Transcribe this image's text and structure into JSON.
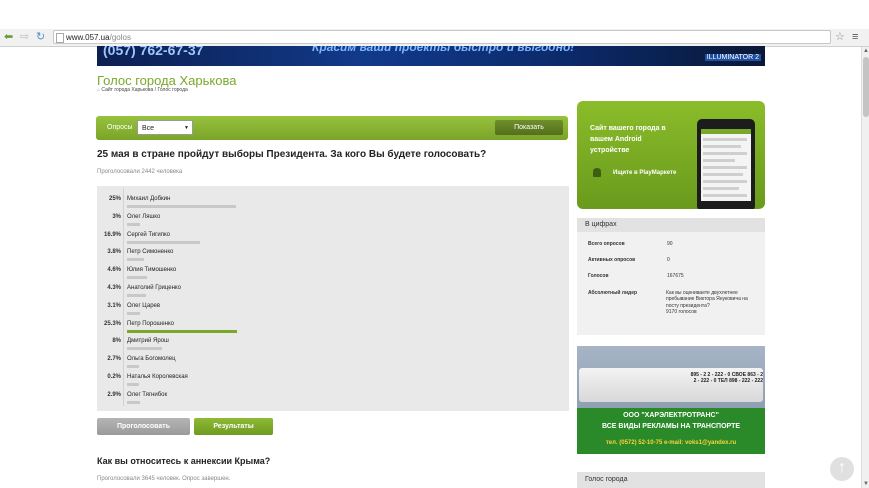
{
  "browser": {
    "url_host": "www.057.ua",
    "url_path": "/golos",
    "back_icon": "arrow-left-icon",
    "forward_icon": "arrow-right-icon",
    "reload_icon": "reload-icon",
    "star_glyph": "☆",
    "menu_glyph": "≡",
    "back_glyph": "⬅",
    "forward_glyph": "⇨",
    "reload_glyph": "↻"
  },
  "banner": {
    "phone": "(057) 762-67-37",
    "slogan": "Красим ваши проекты быстро и выгодно!",
    "brand": "ILLUMINATOR 2"
  },
  "page": {
    "title": "Голос города Харькова",
    "breadcrumb": "Сайт города Харькова / Голос города"
  },
  "filter": {
    "label": "Опросы",
    "selected": "Все",
    "show_button": "Показать"
  },
  "poll": {
    "question": "25 мая в стране пройдут выборы Президента. За кого Вы будете голосовать?",
    "voted": "Проголосовали 2442 человека",
    "options": [
      {
        "pct": "25%",
        "name": "Михаил Добкин",
        "value": 25
      },
      {
        "pct": "3%",
        "name": "Олег Ляшко",
        "value": 3
      },
      {
        "pct": "16.9%",
        "name": "Сергей Тигипко",
        "value": 16.9
      },
      {
        "pct": "3.8%",
        "name": "Петр Симоненко",
        "value": 3.8
      },
      {
        "pct": "4.6%",
        "name": "Юлия Тимошенко",
        "value": 4.6
      },
      {
        "pct": "4.3%",
        "name": "Анатолий Гриценко",
        "value": 4.3
      },
      {
        "pct": "3.1%",
        "name": "Олег Царев",
        "value": 3.1
      },
      {
        "pct": "25.3%",
        "name": "Петр Порошенко",
        "value": 25.3
      },
      {
        "pct": "8%",
        "name": "Дмитрий Ярош",
        "value": 8
      },
      {
        "pct": "2.7%",
        "name": "Ольга Богомолец",
        "value": 2.7
      },
      {
        "pct": "0.2%",
        "name": "Наталья Королевская",
        "value": 0.2
      },
      {
        "pct": "2.9%",
        "name": "Олег Тягнибок",
        "value": 2.9
      }
    ],
    "vote_button": "Проголосовать",
    "results_button": "Результаты"
  },
  "next_poll": {
    "question": "Как вы относитесь к аннексии Крыма?",
    "meta": "Проголосовали 3645 человек. Опрос завершен."
  },
  "sidebar": {
    "app_promo": {
      "text": "Сайт вашего города в вашем Android устройстве",
      "cta": "Ищите в PlayМаркете"
    },
    "stats": {
      "header": "В цифрах",
      "rows": [
        {
          "k": "Всего опросов",
          "v": "90"
        },
        {
          "k": "Активных опросов",
          "v": "0"
        },
        {
          "k": "Голосов",
          "v": "167675"
        }
      ],
      "leader_label": "Абсолютный лидер",
      "leader_link": "Как вы оцениваете двухлетнее пребывание Виктора Януковича на посту президента?",
      "leader_votes": "9170 голосов"
    },
    "ad": {
      "bus_text": "895 - 2 2 - 222 - 0 СВОЕ 863 - 2 2 - 222 - 0 ТЕЛ 898 - 222 - 222",
      "company": "ООО \"ХАРЭЛЕКТРОТРАНС\"",
      "tagline": "ВСЕ ВИДЫ РЕКЛАМЫ НА ТРАНСПОРТЕ",
      "contact": "тел. (0572) 52-10-75 e-mail: voks1@yandex.ru"
    },
    "bottom_header": "Голос города"
  },
  "colors": {
    "accent": "#79a82b",
    "link": "#2a5db0"
  }
}
